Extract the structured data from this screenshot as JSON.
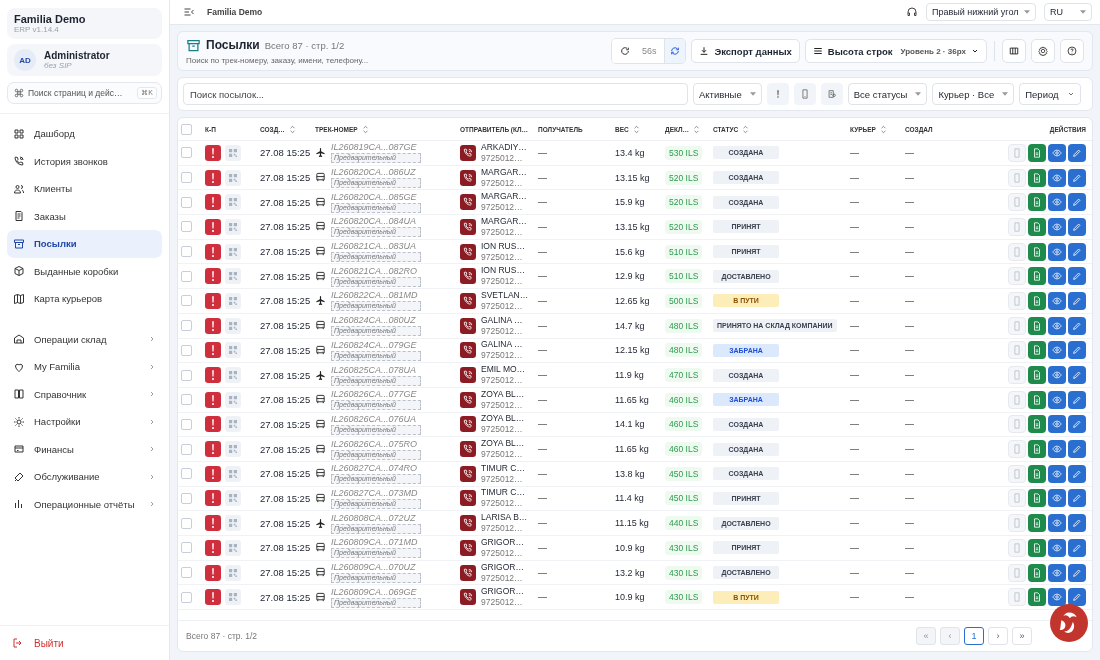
{
  "sidebar": {
    "brand": {
      "title": "Familia Demo",
      "version": "ERP v1.14.4"
    },
    "user": {
      "initials": "AD",
      "name": "Administrator",
      "sip": "без SIP"
    },
    "search": {
      "placeholder": "Поиск страниц и дейс…",
      "shortcut": "⌘K"
    },
    "nav": [
      {
        "label": "Дашборд",
        "selected": false
      },
      {
        "label": "История звонков",
        "selected": false
      },
      {
        "label": "Клиенты",
        "selected": false
      },
      {
        "label": "Заказы",
        "selected": false
      },
      {
        "label": "Посылки",
        "selected": true
      },
      {
        "label": "Выданные коробки",
        "selected": false
      },
      {
        "label": "Карта курьеров",
        "selected": false
      }
    ],
    "groups": [
      {
        "label": "Операции склад",
        "expanded": false
      },
      {
        "label": "My Familia",
        "expanded": false
      },
      {
        "label": "Справочник",
        "expanded": false
      },
      {
        "label": "Настройки",
        "expanded": false
      },
      {
        "label": "Финансы",
        "expanded": false
      },
      {
        "label": "Обслуживание",
        "expanded": false
      },
      {
        "label": "Операционные отчёты",
        "expanded": false
      }
    ],
    "logout": "Выйти"
  },
  "topbar": {
    "title": "Familia Demo",
    "position_select": "Правый нижний угол",
    "language_select": "RU"
  },
  "page_header": {
    "title": "Посылки",
    "summary": "Всего 87 · стр. 1/2",
    "subtitle": "Поиск по трек-номеру, заказу, имени, телефону...",
    "refresh": "56s",
    "auto_refresh": true,
    "export": "Экспорт данных",
    "row_height": {
      "label": "Высота строк",
      "value": "Уровень 2 · 36px"
    }
  },
  "filters": {
    "search_placeholder": "Поиск посылок...",
    "active": "Активные",
    "status": "Все статусы",
    "courier": "Курьер · Все",
    "period": "Период"
  },
  "table": {
    "all_checked": false,
    "columns": [
      {
        "label": "К-П",
        "sortable": false
      },
      {
        "label": "СОЗД…",
        "sortable": true
      },
      {
        "label": "ТРЕК-НОМЕР",
        "sortable": true
      },
      {
        "label": "ОТПРАВИТЕЛЬ (КЛ…",
        "sortable": false
      },
      {
        "label": "ПОЛУЧАТЕЛЬ",
        "sortable": false
      },
      {
        "label": "ВЕС",
        "sortable": true
      },
      {
        "label": "ДЕКЛ…",
        "sortable": true
      },
      {
        "label": "СТАТУС",
        "sortable": true
      },
      {
        "label": "КУРЬЕР",
        "sortable": true
      },
      {
        "label": "СОЗДАЛ",
        "sortable": false
      },
      {
        "label": "ДЕЙСТВИЯ",
        "sortable": false
      }
    ],
    "rows": [
      {
        "checked": false,
        "created": "27.08 15:25",
        "kind": "plane",
        "track": "IL260819CA...087GE",
        "track_tag": "Предварительный",
        "sender": "ARKADIY…",
        "phone": "9725012…",
        "receiver": "—",
        "weight": "13.4 kg",
        "declared": "530 ILS",
        "status": "СОЗДАНА",
        "color": "#eef1f5",
        "courier": "—",
        "creator": "—"
      },
      {
        "checked": false,
        "created": "27.08 15:25",
        "kind": "bus",
        "track": "IL260820CA...086UZ",
        "track_tag": "Предварительный",
        "sender": "MARGAR…",
        "phone": "9725012…",
        "receiver": "—",
        "weight": "13.15 kg",
        "declared": "520 ILS",
        "status": "СОЗДАНА",
        "color": "#eef1f5",
        "courier": "—",
        "creator": "—"
      },
      {
        "checked": false,
        "created": "27.08 15:25",
        "kind": "bus",
        "track": "IL260820CA...085GE",
        "track_tag": "Предварительный",
        "sender": "MARGAR…",
        "phone": "9725012…",
        "receiver": "—",
        "weight": "15.9 kg",
        "declared": "520 ILS",
        "status": "СОЗДАНА",
        "color": "#eef1f5",
        "courier": "—",
        "creator": "—"
      },
      {
        "checked": false,
        "created": "27.08 15:25",
        "kind": "bus",
        "track": "IL260820CA...084UA",
        "track_tag": "Предварительный",
        "sender": "MARGAR…",
        "phone": "9725012…",
        "receiver": "—",
        "weight": "13.15 kg",
        "declared": "520 ILS",
        "status": "ПРИНЯТ",
        "color": "#eef1f5",
        "courier": "—",
        "creator": "—"
      },
      {
        "checked": false,
        "created": "27.08 15:25",
        "kind": "bus",
        "track": "IL260821CA...083UA",
        "track_tag": "Предварительный",
        "sender": "ION RUS…",
        "phone": "9725012…",
        "receiver": "—",
        "weight": "15.6 kg",
        "declared": "510 ILS",
        "status": "ПРИНЯТ",
        "color": "#eef1f5",
        "courier": "—",
        "creator": "—"
      },
      {
        "checked": false,
        "created": "27.08 15:25",
        "kind": "bus",
        "track": "IL260821CA...082RO",
        "track_tag": "Предварительный",
        "sender": "ION RUS…",
        "phone": "9725012…",
        "receiver": "—",
        "weight": "12.9 kg",
        "declared": "510 ILS",
        "status": "ДОСТАВЛЕНО",
        "color": "#eef1f5",
        "courier": "—",
        "creator": "—"
      },
      {
        "checked": false,
        "created": "27.08 15:25",
        "kind": "plane",
        "track": "IL260822CA...081MD",
        "track_tag": "Предварительный",
        "sender": "SVETLAN…",
        "phone": "9725012…",
        "receiver": "—",
        "weight": "12.65 kg",
        "declared": "500 ILS",
        "status": "В ПУТИ",
        "color": "#fdedb9",
        "courier": "—",
        "creator": "—"
      },
      {
        "checked": false,
        "created": "27.08 15:25",
        "kind": "bus",
        "track": "IL260824CA...080UZ",
        "track_tag": "Предварительный",
        "sender": "GALINA …",
        "phone": "9725012…",
        "receiver": "—",
        "weight": "14.7 kg",
        "declared": "480 ILS",
        "status": "ПРИНЯТО НА СКЛАД КОМПАНИИ",
        "color": "#eef1f5",
        "courier": "—",
        "creator": "—"
      },
      {
        "checked": false,
        "created": "27.08 15:25",
        "kind": "bus",
        "track": "IL260824CA...079GE",
        "track_tag": "Предварительный",
        "sender": "GALINA …",
        "phone": "9725012…",
        "receiver": "—",
        "weight": "12.15 kg",
        "declared": "480 ILS",
        "status": "ЗАБРАНА",
        "color": "#dce9fd",
        "courier": "—",
        "creator": "—"
      },
      {
        "checked": false,
        "created": "27.08 15:25",
        "kind": "plane",
        "track": "IL260825CA...078UA",
        "track_tag": "Предварительный",
        "sender": "EMIL MO…",
        "phone": "9725012…",
        "receiver": "—",
        "weight": "11.9 kg",
        "declared": "470 ILS",
        "status": "СОЗДАНА",
        "color": "#eef1f5",
        "courier": "—",
        "creator": "—"
      },
      {
        "checked": false,
        "created": "27.08 15:25",
        "kind": "bus",
        "track": "IL260826CA...077GE",
        "track_tag": "Предварительный",
        "sender": "ZOYA BL…",
        "phone": "9725012…",
        "receiver": "—",
        "weight": "11.65 kg",
        "declared": "460 ILS",
        "status": "ЗАБРАНА",
        "color": "#dce9fd",
        "courier": "—",
        "creator": "—"
      },
      {
        "checked": false,
        "created": "27.08 15:25",
        "kind": "bus",
        "track": "IL260826CA...076UA",
        "track_tag": "Предварительный",
        "sender": "ZOYA BL…",
        "phone": "9725012…",
        "receiver": "—",
        "weight": "14.1 kg",
        "declared": "460 ILS",
        "status": "СОЗДАНА",
        "color": "#eef1f5",
        "courier": "—",
        "creator": "—"
      },
      {
        "checked": false,
        "created": "27.08 15:25",
        "kind": "bus",
        "track": "IL260826CA...075RO",
        "track_tag": "Предварительный",
        "sender": "ZOYA BL…",
        "phone": "9725012…",
        "receiver": "—",
        "weight": "11.65 kg",
        "declared": "460 ILS",
        "status": "СОЗДАНА",
        "color": "#eef1f5",
        "courier": "—",
        "creator": "—"
      },
      {
        "checked": false,
        "created": "27.08 15:25",
        "kind": "bus",
        "track": "IL260827CA...074RO",
        "track_tag": "Предварительный",
        "sender": "TIMUR C…",
        "phone": "9725012…",
        "receiver": "—",
        "weight": "13.8 kg",
        "declared": "450 ILS",
        "status": "СОЗДАНА",
        "color": "#eef1f5",
        "courier": "—",
        "creator": "—"
      },
      {
        "checked": false,
        "created": "27.08 15:25",
        "kind": "bus",
        "track": "IL260827CA...073MD",
        "track_tag": "Предварительный",
        "sender": "TIMUR C…",
        "phone": "9725012…",
        "receiver": "—",
        "weight": "11.4 kg",
        "declared": "450 ILS",
        "status": "ПРИНЯТ",
        "color": "#eef1f5",
        "courier": "—",
        "creator": "—"
      },
      {
        "checked": false,
        "created": "27.08 15:25",
        "kind": "plane",
        "track": "IL260808CA...072UZ",
        "track_tag": "Предварительный",
        "sender": "LARISA B…",
        "phone": "9725012…",
        "receiver": "—",
        "weight": "11.15 kg",
        "declared": "440 ILS",
        "status": "ДОСТАВЛЕНО",
        "color": "#eef1f5",
        "courier": "—",
        "creator": "—"
      },
      {
        "checked": false,
        "created": "27.08 15:25",
        "kind": "bus",
        "track": "IL260809CA...071MD",
        "track_tag": "Предварительный",
        "sender": "GRIGOR…",
        "phone": "9725012…",
        "receiver": "—",
        "weight": "10.9 kg",
        "declared": "430 ILS",
        "status": "ПРИНЯТ",
        "color": "#eef1f5",
        "courier": "—",
        "creator": "—"
      },
      {
        "checked": false,
        "created": "27.08 15:25",
        "kind": "bus",
        "track": "IL260809CA...070UZ",
        "track_tag": "Предварительный",
        "sender": "GRIGOR…",
        "phone": "9725012…",
        "receiver": "—",
        "weight": "13.2 kg",
        "declared": "430 ILS",
        "status": "ДОСТАВЛЕНО",
        "color": "#eef1f5",
        "courier": "—",
        "creator": "—"
      },
      {
        "checked": false,
        "created": "27.08 15:25",
        "kind": "bus",
        "track": "IL260809CA...069GE",
        "track_tag": "Предварительный",
        "sender": "GRIGOR…",
        "phone": "9725012…",
        "receiver": "—",
        "weight": "10.9 kg",
        "declared": "430 ILS",
        "status": "В ПУТИ",
        "color": "#fdedb9",
        "courier": "—",
        "creator": "—"
      }
    ]
  },
  "footer": {
    "summary": "Всего 87 · стр. 1/2",
    "pager": [
      {
        "label": "«",
        "selected": false,
        "disabled": true
      },
      {
        "label": "‹",
        "selected": false,
        "disabled": true
      },
      {
        "label": "1",
        "selected": true,
        "disabled": false
      },
      {
        "label": "›",
        "selected": false,
        "disabled": false
      },
      {
        "label": "»",
        "selected": false,
        "disabled": false
      }
    ]
  }
}
